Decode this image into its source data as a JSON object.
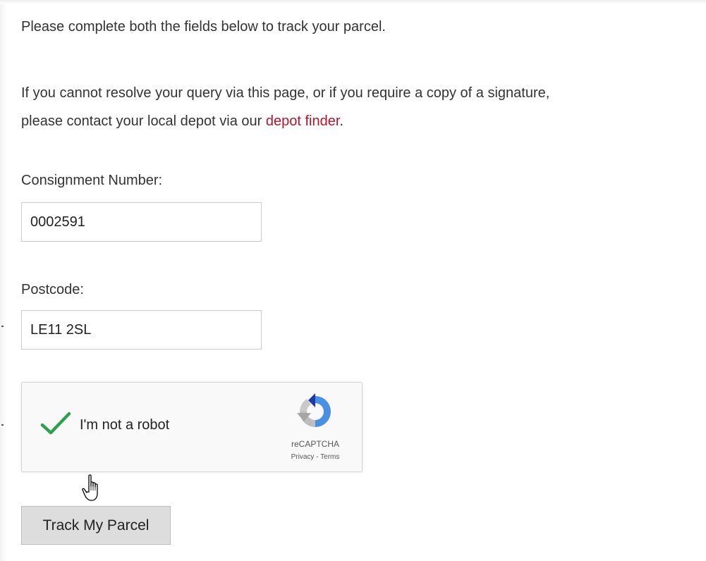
{
  "intro": {
    "text": "Please complete both the fields below to track your parcel."
  },
  "resolve": {
    "line1": "If you cannot resolve your query via this page, or if you require a copy of a signature,",
    "line2_prefix": "please contact your local depot via our ",
    "link_text": "depot finder",
    "line2_suffix": "."
  },
  "form": {
    "consignment": {
      "label": "Consignment Number:",
      "value": "0002591"
    },
    "postcode": {
      "label": "Postcode:",
      "value": "LE11 2SL"
    }
  },
  "captcha": {
    "label": "I'm not a robot",
    "checked": true,
    "brand": "reCAPTCHA",
    "privacy": "Privacy",
    "separator": " - ",
    "terms": "Terms",
    "check_color": "#2e9e4f",
    "icon": "recaptcha-logo-icon"
  },
  "submit": {
    "label": "Track My Parcel"
  },
  "colors": {
    "link": "#b5142b",
    "button_bg": "#dddddd"
  },
  "cursor": {
    "icon": "hand-pointer-icon"
  }
}
